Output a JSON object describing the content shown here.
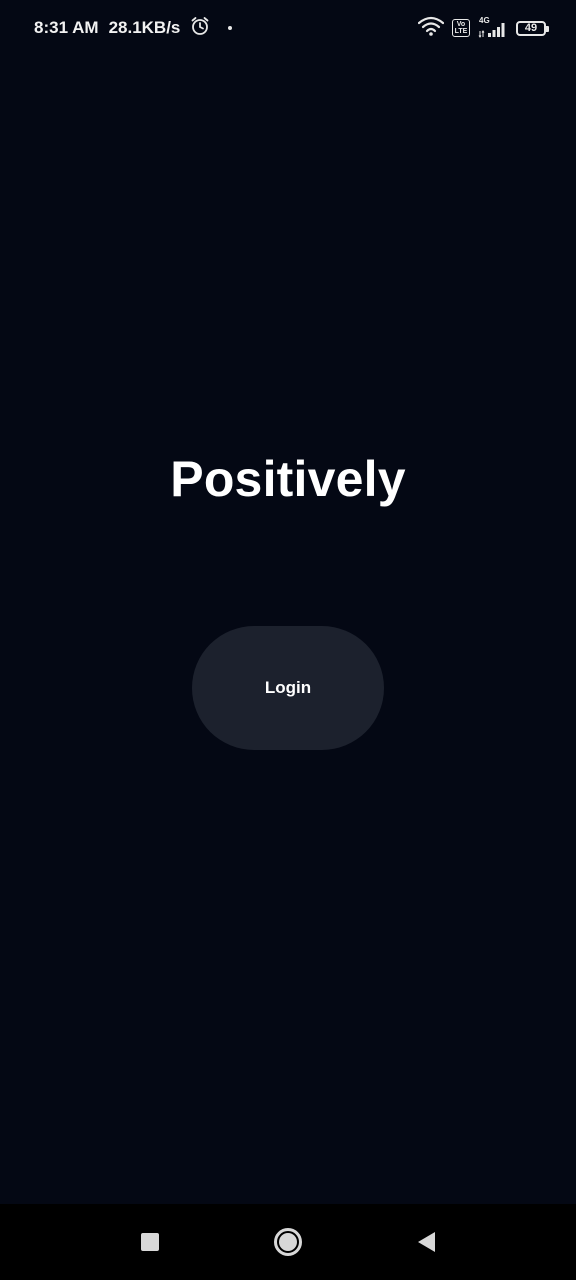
{
  "status_bar": {
    "time": "8:31 AM",
    "net_speed": "28.1KB/s",
    "alarm_icon": "alarm-clock-icon",
    "volte_top": "Vo",
    "volte_bottom": "LTE",
    "network_type": "4G",
    "battery_level": "49"
  },
  "main": {
    "title": "Positively",
    "login_label": "Login"
  },
  "nav_bar": {
    "recents_icon": "square-recents-icon",
    "home_icon": "circle-home-icon",
    "back_icon": "triangle-back-icon"
  },
  "colors": {
    "background": "#040814",
    "button": "#1c212d",
    "text": "#ffffff",
    "nav_bar": "#000000"
  }
}
